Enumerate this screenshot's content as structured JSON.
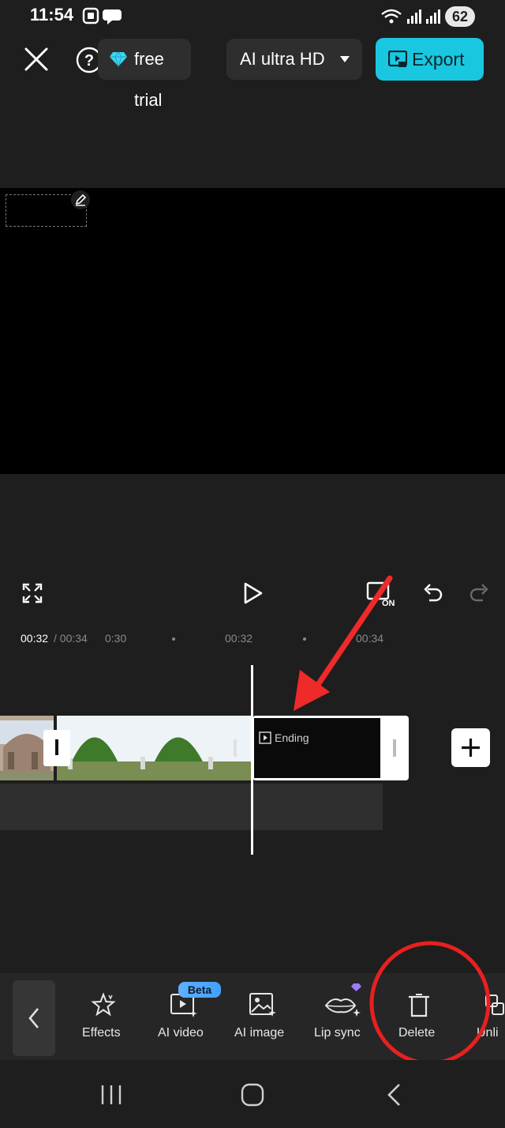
{
  "status_bar": {
    "time": "11:54",
    "battery": "62"
  },
  "top_bar": {
    "trial_label": "free trial",
    "quality_label": "AI ultra HD",
    "export_label": "Export"
  },
  "playback": {
    "current_time": "00:32",
    "total_time": "/ 00:34"
  },
  "ruler": {
    "ticks": [
      "0:30",
      "00:32",
      "00:34"
    ]
  },
  "timeline": {
    "ending_label": "Ending"
  },
  "toolbar": {
    "effects": "Effects",
    "ai_video": "AI video",
    "ai_video_badge": "Beta",
    "ai_image": "AI image",
    "lip_sync": "Lip sync",
    "delete": "Delete",
    "next_partial": "Unli"
  },
  "annotations": {
    "arrow_color": "#ee2a2a",
    "circle_color": "#e82020"
  },
  "colors": {
    "accent": "#19c8e0",
    "background": "#1e1e1e"
  }
}
